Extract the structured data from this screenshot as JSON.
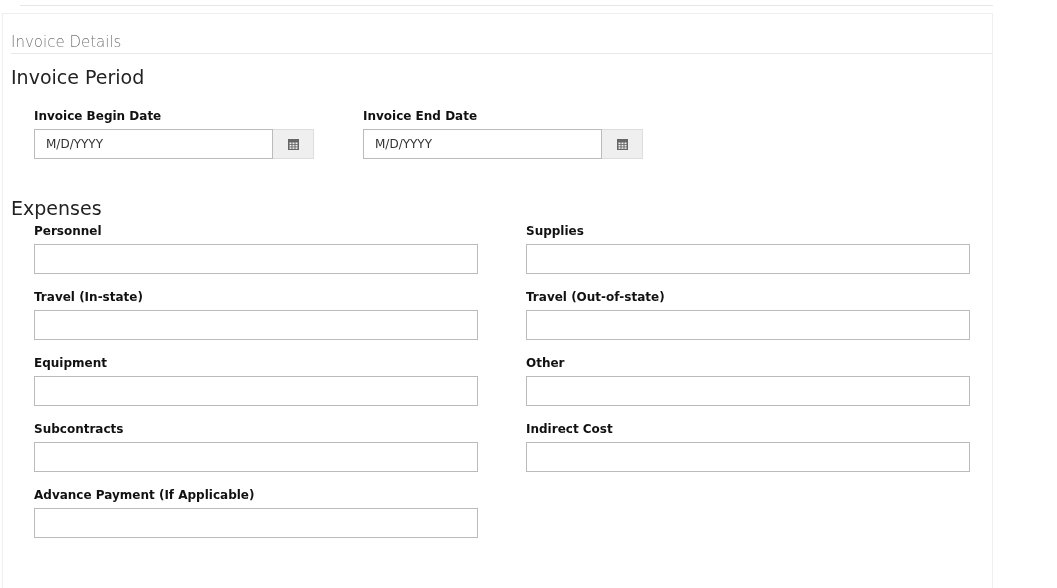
{
  "panel": {
    "title": "Invoice Details"
  },
  "invoice_period": {
    "heading": "Invoice Period",
    "fields": [
      {
        "label": "Invoice Begin Date",
        "placeholder": "M/D/YYYY"
      },
      {
        "label": "Invoice End Date",
        "placeholder": "M/D/YYYY"
      }
    ]
  },
  "expenses": {
    "heading": "Expenses",
    "fields": [
      {
        "label": "Personnel"
      },
      {
        "label": "Supplies"
      },
      {
        "label": "Travel (In-state)"
      },
      {
        "label": "Travel (Out-of-state)"
      },
      {
        "label": "Equipment"
      },
      {
        "label": "Other"
      },
      {
        "label": "Subcontracts"
      },
      {
        "label": "Indirect Cost"
      },
      {
        "label": "Advance Payment (If Applicable)"
      }
    ]
  }
}
